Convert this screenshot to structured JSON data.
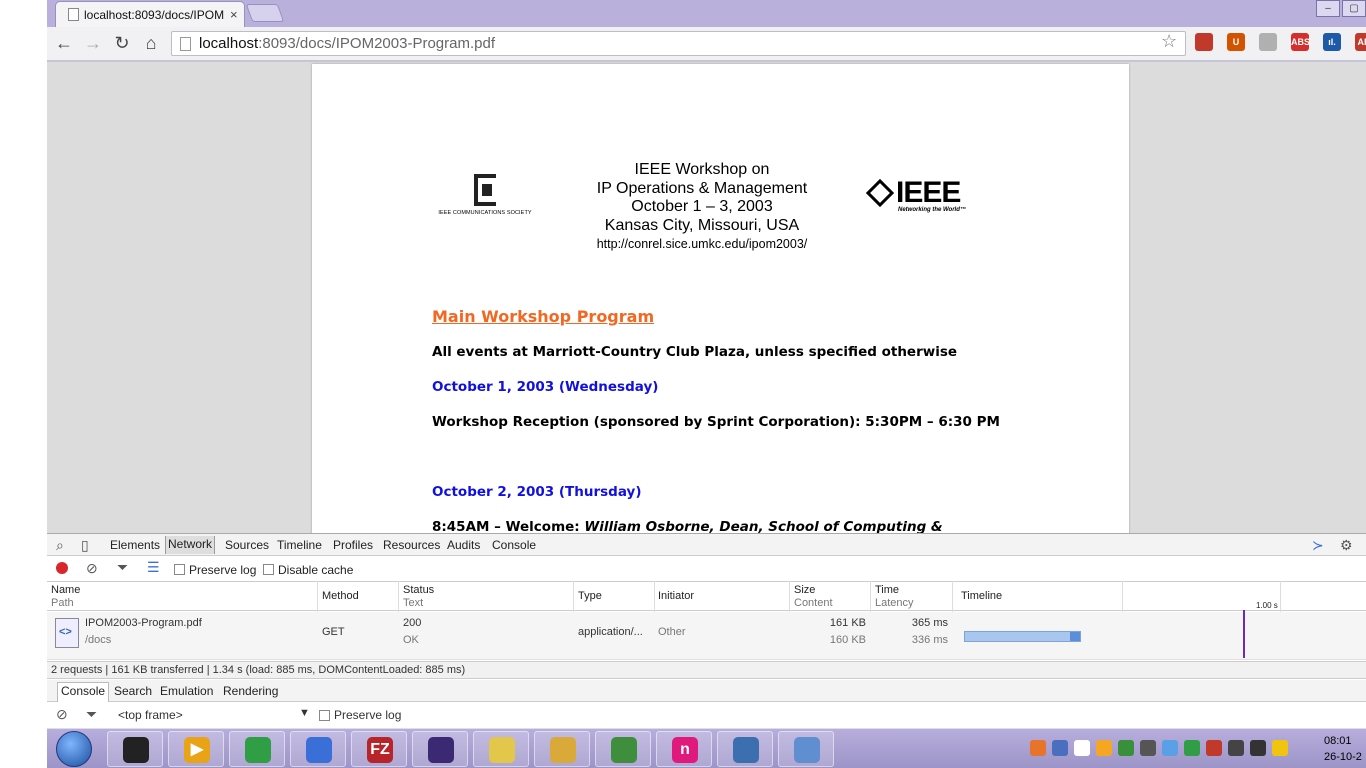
{
  "browser": {
    "tab_title": "localhost:8093/docs/IPOM",
    "tab_close": "×",
    "window_buttons": [
      "–",
      "▢"
    ],
    "url_host": "localhost",
    "url_rest": ":8093/docs/IPOM2003-Program.pdf",
    "extensions": [
      {
        "name": "bookmark-ext-icon",
        "label": "",
        "color": "#c0392b"
      },
      {
        "name": "ublock-ext-icon",
        "label": "U",
        "color": "#d35400"
      },
      {
        "name": "circle-ext-icon",
        "label": "",
        "color": "#b0b0b0"
      },
      {
        "name": "adblock-ext-icon",
        "label": "ABS",
        "color": "#d62d2d"
      },
      {
        "name": "chart-ext-icon",
        "label": "ıl.",
        "color": "#1e5aa8"
      },
      {
        "name": "adblock-plus-ext-icon",
        "label": "AB",
        "color": "#c0392b"
      }
    ]
  },
  "pdf": {
    "header_lines": [
      "IEEE Workshop on",
      "IP Operations & Management",
      "October 1 – 3, 2003",
      "Kansas City, Missouri, USA"
    ],
    "header_url": "http://conrel.sice.umkc.edu/ipom2003/",
    "comsoc_text": "IEEE COMMUNICATIONS SOCIETY",
    "ieee_logo": "IEEE",
    "ieee_tagline": "Networking the World™",
    "program_title": "Main Workshop Program",
    "venue_line": "All events at Marriott-Country Club Plaza, unless specified otherwise",
    "day1": "October 1, 2003 (Wednesday)",
    "reception": "Workshop Reception (sponsored by Sprint Corporation):  5:30PM – 6:30 PM",
    "day2": "October 2, 2003 (Thursday)",
    "welcome_prefix": "8:45AM – Welcome: ",
    "welcome_name": "William Osborne, Dean, School of Computing &"
  },
  "devtools": {
    "tabs": [
      "Elements",
      "Network",
      "Sources",
      "Timeline",
      "Profiles",
      "Resources",
      "Audits",
      "Console"
    ],
    "preserve_log": "Preserve log",
    "disable_cache": "Disable cache",
    "columns": {
      "name": "Name",
      "path": "Path",
      "method": "Method",
      "status": "Status",
      "text": "Text",
      "type": "Type",
      "initiator": "Initiator",
      "size": "Size",
      "content": "Content",
      "time": "Time",
      "latency": "Latency",
      "timeline": "Timeline",
      "tick": "1.00 s"
    },
    "request": {
      "name": "IPOM2003-Program.pdf",
      "path": "/docs",
      "method": "GET",
      "status": "200",
      "status_text": "OK",
      "type": "application/...",
      "initiator": "Other",
      "size": "161 KB",
      "content": "160 KB",
      "time": "365 ms",
      "latency": "336 ms"
    },
    "summary": "2 requests | 161 KB transferred | 1.34 s (load: 885 ms, DOMContentLoaded: 885 ms)",
    "drawer_tabs": [
      "Console",
      "Search",
      "Emulation",
      "Rendering"
    ],
    "frame_select": "<top frame>",
    "console_preserve_log": "Preserve log"
  },
  "taskbar": {
    "apps": [
      {
        "name": "media-player-app",
        "label": "",
        "color": "#222"
      },
      {
        "name": "media-app",
        "label": "▶",
        "color": "#e8a317"
      },
      {
        "name": "chrome-app",
        "label": "",
        "color": "#2f9e44"
      },
      {
        "name": "network-app",
        "label": "",
        "color": "#3a6fd8"
      },
      {
        "name": "filezilla-app",
        "label": "FZ",
        "color": "#b7242a"
      },
      {
        "name": "eclipse-app",
        "label": "",
        "color": "#3b2a73"
      },
      {
        "name": "notes-app",
        "label": "",
        "color": "#e3c74a"
      },
      {
        "name": "explorer-app",
        "label": "",
        "color": "#d9a93a"
      },
      {
        "name": "chart-app",
        "label": "",
        "color": "#3e8e3e"
      },
      {
        "name": "n-app",
        "label": "n",
        "color": "#e0197d"
      },
      {
        "name": "python-app",
        "label": "",
        "color": "#3b6fb0"
      },
      {
        "name": "paint-app",
        "label": "",
        "color": "#5f8fd1"
      }
    ],
    "clock_time": "08:01",
    "clock_date": "26-10-2"
  }
}
